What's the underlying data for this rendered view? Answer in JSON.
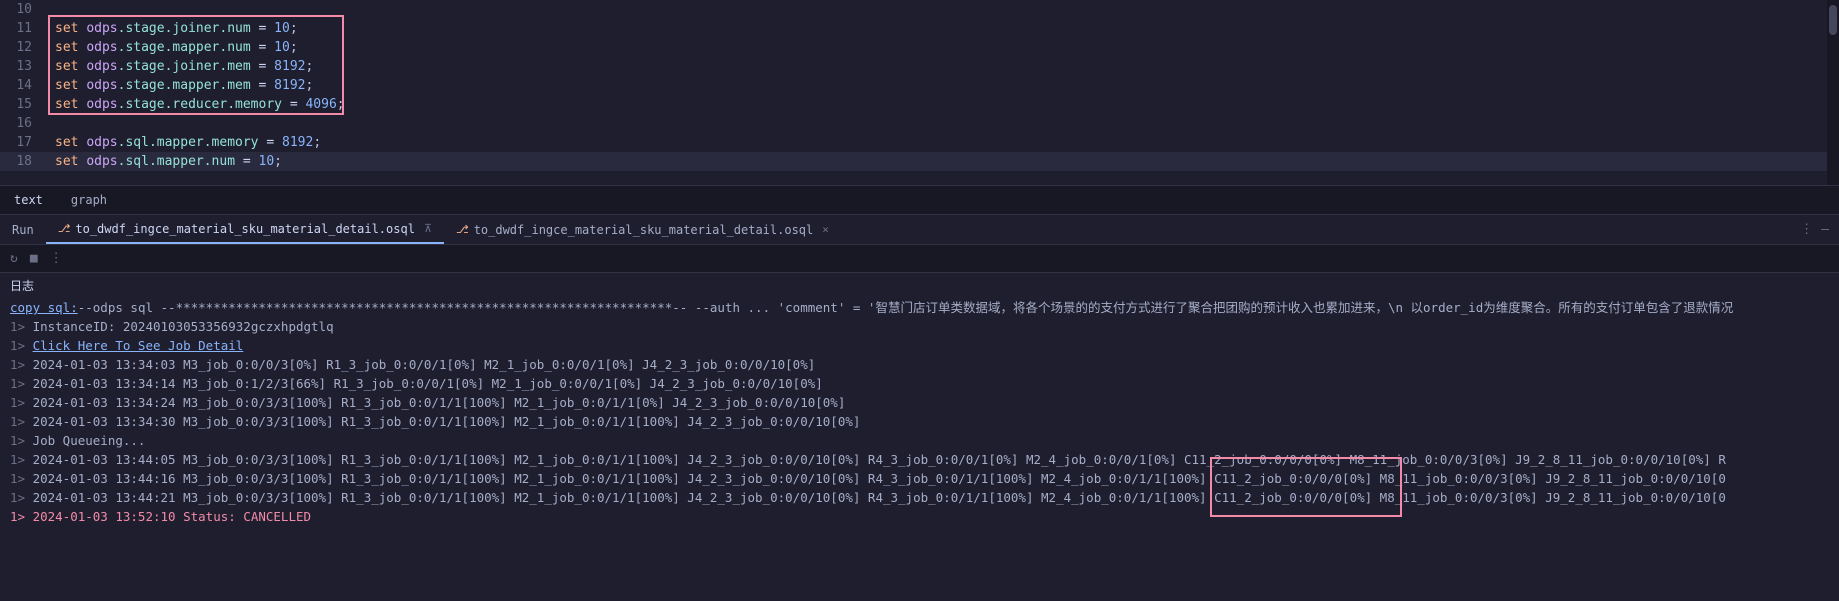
{
  "editor": {
    "lines": [
      {
        "num": 10,
        "tokens": []
      },
      {
        "num": 11,
        "tokens": [
          {
            "c": "kw-set",
            "t": "set"
          },
          {
            "c": "",
            "t": " "
          },
          {
            "c": "kw-odps",
            "t": "odps"
          },
          {
            "c": "kw-path",
            "t": ".stage.joiner.num"
          },
          {
            "c": "",
            "t": " "
          },
          {
            "c": "kw-eq",
            "t": "="
          },
          {
            "c": "",
            "t": " "
          },
          {
            "c": "kw-num",
            "t": "10"
          },
          {
            "c": "kw-semi",
            "t": ";"
          }
        ]
      },
      {
        "num": 12,
        "tokens": [
          {
            "c": "kw-set",
            "t": "set"
          },
          {
            "c": "",
            "t": " "
          },
          {
            "c": "kw-odps",
            "t": "odps"
          },
          {
            "c": "kw-path",
            "t": ".stage.mapper.num"
          },
          {
            "c": "",
            "t": " "
          },
          {
            "c": "kw-eq",
            "t": "="
          },
          {
            "c": "",
            "t": " "
          },
          {
            "c": "kw-num",
            "t": "10"
          },
          {
            "c": "kw-semi",
            "t": ";"
          }
        ]
      },
      {
        "num": 13,
        "tokens": [
          {
            "c": "kw-set",
            "t": "set"
          },
          {
            "c": "",
            "t": " "
          },
          {
            "c": "kw-odps",
            "t": "odps"
          },
          {
            "c": "kw-path",
            "t": ".stage.joiner.mem"
          },
          {
            "c": "",
            "t": " "
          },
          {
            "c": "kw-eq",
            "t": "="
          },
          {
            "c": "",
            "t": " "
          },
          {
            "c": "kw-num",
            "t": "8192"
          },
          {
            "c": "kw-semi",
            "t": ";"
          }
        ]
      },
      {
        "num": 14,
        "tokens": [
          {
            "c": "kw-set",
            "t": "set"
          },
          {
            "c": "",
            "t": " "
          },
          {
            "c": "kw-odps",
            "t": "odps"
          },
          {
            "c": "kw-path",
            "t": ".stage.mapper.mem"
          },
          {
            "c": "",
            "t": " "
          },
          {
            "c": "kw-eq",
            "t": "="
          },
          {
            "c": "",
            "t": " "
          },
          {
            "c": "kw-num",
            "t": "8192"
          },
          {
            "c": "kw-semi",
            "t": ";"
          }
        ]
      },
      {
        "num": 15,
        "tokens": [
          {
            "c": "kw-set",
            "t": "set"
          },
          {
            "c": "",
            "t": " "
          },
          {
            "c": "kw-odps",
            "t": "odps"
          },
          {
            "c": "kw-path",
            "t": ".stage.reducer.memory"
          },
          {
            "c": "",
            "t": " "
          },
          {
            "c": "kw-eq",
            "t": "="
          },
          {
            "c": "",
            "t": " "
          },
          {
            "c": "kw-num",
            "t": "4096"
          },
          {
            "c": "kw-semi",
            "t": ";"
          }
        ]
      },
      {
        "num": 16,
        "tokens": []
      },
      {
        "num": 17,
        "tokens": [
          {
            "c": "kw-set",
            "t": "set"
          },
          {
            "c": "",
            "t": " "
          },
          {
            "c": "kw-odps",
            "t": "odps"
          },
          {
            "c": "kw-path",
            "t": ".sql"
          },
          {
            "c": "kw-path",
            "t": ".mapper.memory"
          },
          {
            "c": "",
            "t": " "
          },
          {
            "c": "kw-eq",
            "t": "="
          },
          {
            "c": "",
            "t": " "
          },
          {
            "c": "kw-num",
            "t": "8192"
          },
          {
            "c": "kw-semi",
            "t": ";"
          }
        ]
      },
      {
        "num": 18,
        "tokens": [
          {
            "c": "kw-set",
            "t": "set"
          },
          {
            "c": "",
            "t": " "
          },
          {
            "c": "kw-odps",
            "t": "odps"
          },
          {
            "c": "kw-path",
            "t": ".sql"
          },
          {
            "c": "kw-path",
            "t": ".mapper.num"
          },
          {
            "c": "",
            "t": " "
          },
          {
            "c": "kw-eq",
            "t": "="
          },
          {
            "c": "",
            "t": " "
          },
          {
            "c": "kw-num",
            "t": "10"
          },
          {
            "c": "kw-semi",
            "t": ";"
          }
        ]
      }
    ]
  },
  "viewTabs": {
    "text": "text",
    "graph": "graph"
  },
  "runPanel": {
    "runLabel": "Run",
    "file1": "to_dwdf_ingce_material_sku_material_detail.osql",
    "file2": "to_dwdf_ingce_material_sku_material_detail.osql",
    "logLabel": "日志"
  },
  "console": {
    "copySql": "copy sql:",
    "sqlComment": "--odps sql --******************************************************************-- --auth ... 'comment' = '智慧门店订单类数据域，将各个场景的的支付方式进行了聚合把团购的预计收入也累加进来，\\n  以order_id为维度聚合。所有的支付订单包含了退款情况",
    "instanceId": "InstanceID: 20240103053356932gczxhpdgtlq",
    "jobDetail": "Click Here To See Job Detail",
    "lines": [
      "2024-01-03 13:34:03 M3_job_0:0/0/3[0%] R1_3_job_0:0/0/1[0%] M2_1_job_0:0/0/1[0%] J4_2_3_job_0:0/0/10[0%]",
      "2024-01-03 13:34:14 M3_job_0:1/2/3[66%] R1_3_job_0:0/0/1[0%] M2_1_job_0:0/0/1[0%] J4_2_3_job_0:0/0/10[0%]",
      "2024-01-03 13:34:24 M3_job_0:0/3/3[100%] R1_3_job_0:0/1/1[100%] M2_1_job_0:0/1/1[0%] J4_2_3_job_0:0/0/10[0%]",
      "2024-01-03 13:34:30 M3_job_0:0/3/3[100%] R1_3_job_0:0/1/1[100%] M2_1_job_0:0/1/1[100%] J4_2_3_job_0:0/0/10[0%]",
      "Job Queueing...",
      "2024-01-03 13:44:05 M3_job_0:0/3/3[100%] R1_3_job_0:0/1/1[100%] M2_1_job_0:0/1/1[100%] J4_2_3_job_0:0/0/10[0%] R4_3_job_0:0/0/1[0%] M2_4_job_0:0/0/1[0%] C11_2_job_0:0/0/0[0%] M8_11_job_0:0/0/3[0%] J9_2_8_11_job_0:0/0/10[0%] R",
      "2024-01-03 13:44:16 M3_job_0:0/3/3[100%] R1_3_job_0:0/1/1[100%] M2_1_job_0:0/1/1[100%] J4_2_3_job_0:0/0/10[0%] R4_3_job_0:0/1/1[100%] M2_4_job_0:0/1/1[100%] C11_2_job_0:0/0/0[0%] M8_11_job_0:0/0/3[0%] J9_2_8_11_job_0:0/0/10[0",
      "2024-01-03 13:44:21 M3_job_0:0/3/3[100%] R1_3_job_0:0/1/1[100%] M2_1_job_0:0/1/1[100%] J4_2_3_job_0:0/0/10[0%] R4_3_job_0:0/1/1[100%] M2_4_job_0:0/1/1[100%] C11_2_job_0:0/0/0[0%] M8_11_job_0:0/0/3[0%] J9_2_8_11_job_0:0/0/10[0"
    ],
    "cancelled": "2024-01-03 13:52:10 Status: CANCELLED"
  }
}
